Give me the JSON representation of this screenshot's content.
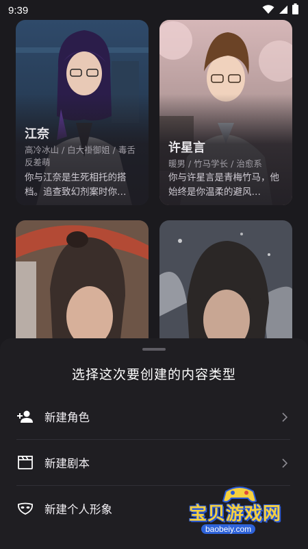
{
  "status_bar": {
    "time": "9:39"
  },
  "cards": [
    {
      "name": "江奈",
      "tags": "高冷冰山 / 白大褂御姐 / 毒舌反差萌",
      "desc": "你与江奈是生死相托的搭档。追查致幻剂案时你…"
    },
    {
      "name": "许星言",
      "tags": "暖男 / 竹马学长 / 治愈系",
      "desc": "你与许星言是青梅竹马，他始终是你温柔的避风…"
    },
    {
      "name": "",
      "tags": "",
      "desc": ""
    },
    {
      "name": "",
      "tags": "",
      "desc": ""
    }
  ],
  "sheet": {
    "title": "选择这次要创建的内容类型",
    "options": [
      {
        "label": "新建角色",
        "icon": "add-person-icon"
      },
      {
        "label": "新建剧本",
        "icon": "clapperboard-icon"
      },
      {
        "label": "新建个人形象",
        "icon": "mask-icon"
      }
    ]
  },
  "watermark": {
    "text": "宝贝游戏网",
    "url": "baobeiy.com"
  },
  "colors": {
    "background": "#1b1a1e",
    "sheet": "#1f1e22",
    "watermark_yellow": "#f6d03e",
    "watermark_blue": "#2e63d9"
  }
}
